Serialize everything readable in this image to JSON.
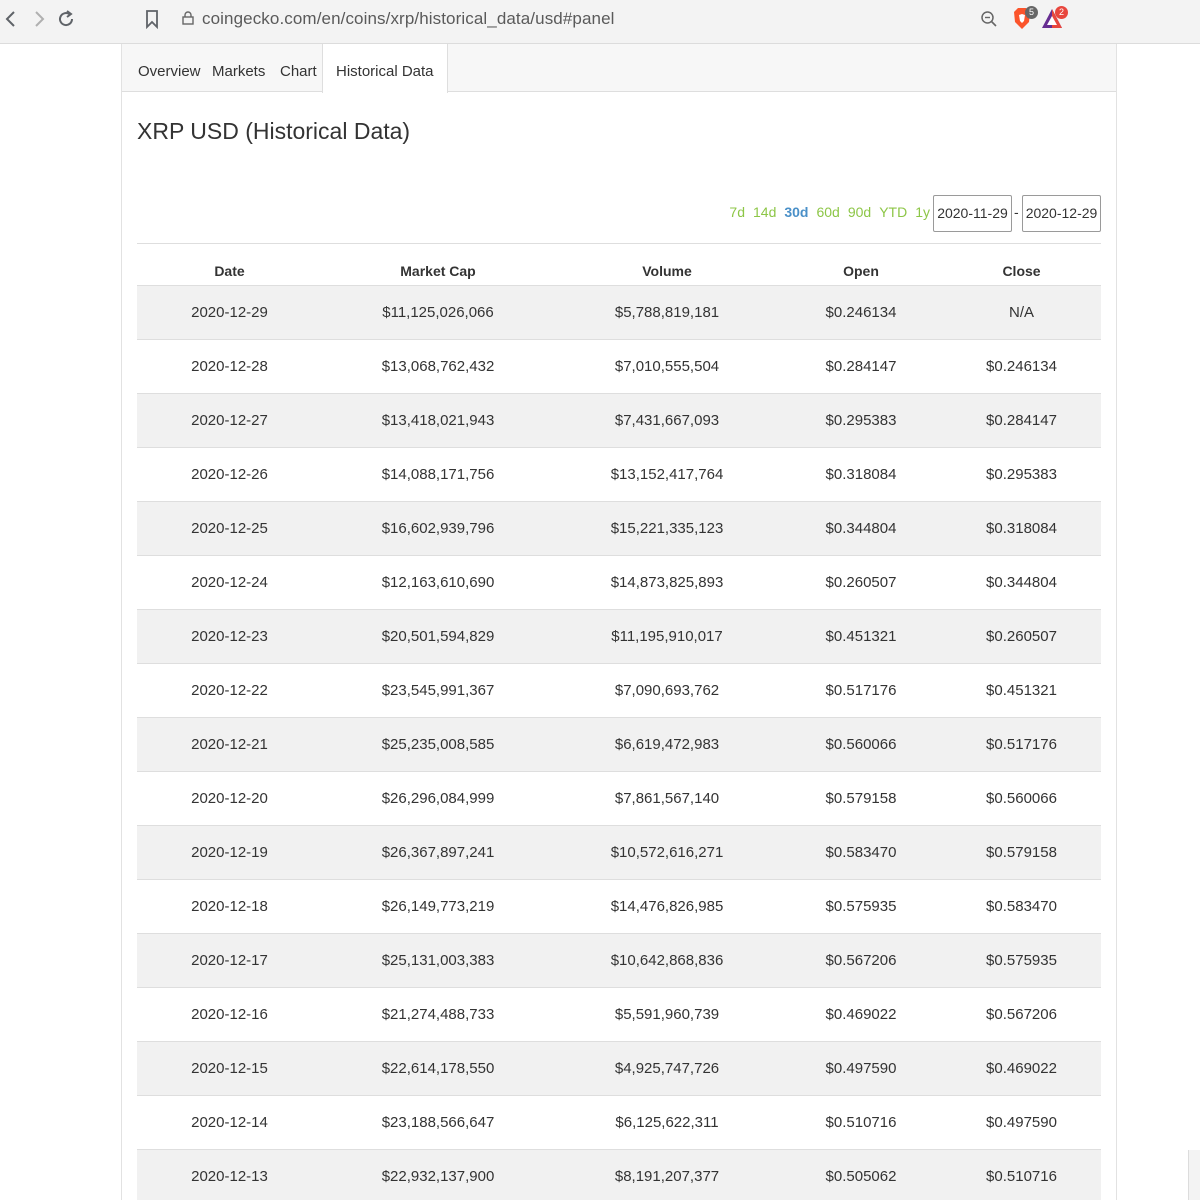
{
  "browser": {
    "url": "coingecko.com/en/coins/xrp/historical_data/usd#panel",
    "brave_shields_count": "5",
    "rewards_count": "2"
  },
  "tabs": [
    {
      "label": "Overview"
    },
    {
      "label": "Markets"
    },
    {
      "label": "Chart"
    },
    {
      "label": "Historical Data"
    }
  ],
  "page_title": "XRP USD (Historical Data)",
  "range_links": [
    "7d",
    "14d",
    "30d",
    "60d",
    "90d",
    "YTD",
    "1y"
  ],
  "active_range": "30d",
  "date_from": "2020-11-29",
  "date_to": "2020-12-29",
  "date_separator": "-",
  "table": {
    "headers": [
      "Date",
      "Market Cap",
      "Volume",
      "Open",
      "Close"
    ],
    "rows": [
      [
        "2020-12-29",
        "$11,125,026,066",
        "$5,788,819,181",
        "$0.246134",
        "N/A"
      ],
      [
        "2020-12-28",
        "$13,068,762,432",
        "$7,010,555,504",
        "$0.284147",
        "$0.246134"
      ],
      [
        "2020-12-27",
        "$13,418,021,943",
        "$7,431,667,093",
        "$0.295383",
        "$0.284147"
      ],
      [
        "2020-12-26",
        "$14,088,171,756",
        "$13,152,417,764",
        "$0.318084",
        "$0.295383"
      ],
      [
        "2020-12-25",
        "$16,602,939,796",
        "$15,221,335,123",
        "$0.344804",
        "$0.318084"
      ],
      [
        "2020-12-24",
        "$12,163,610,690",
        "$14,873,825,893",
        "$0.260507",
        "$0.344804"
      ],
      [
        "2020-12-23",
        "$20,501,594,829",
        "$11,195,910,017",
        "$0.451321",
        "$0.260507"
      ],
      [
        "2020-12-22",
        "$23,545,991,367",
        "$7,090,693,762",
        "$0.517176",
        "$0.451321"
      ],
      [
        "2020-12-21",
        "$25,235,008,585",
        "$6,619,472,983",
        "$0.560066",
        "$0.517176"
      ],
      [
        "2020-12-20",
        "$26,296,084,999",
        "$7,861,567,140",
        "$0.579158",
        "$0.560066"
      ],
      [
        "2020-12-19",
        "$26,367,897,241",
        "$10,572,616,271",
        "$0.583470",
        "$0.579158"
      ],
      [
        "2020-12-18",
        "$26,149,773,219",
        "$14,476,826,985",
        "$0.575935",
        "$0.583470"
      ],
      [
        "2020-12-17",
        "$25,131,003,383",
        "$10,642,868,836",
        "$0.567206",
        "$0.575935"
      ],
      [
        "2020-12-16",
        "$21,274,488,733",
        "$5,591,960,739",
        "$0.469022",
        "$0.567206"
      ],
      [
        "2020-12-15",
        "$22,614,178,550",
        "$4,925,747,726",
        "$0.497590",
        "$0.469022"
      ],
      [
        "2020-12-14",
        "$23,188,566,647",
        "$6,125,622,311",
        "$0.510716",
        "$0.497590"
      ],
      [
        "2020-12-13",
        "$22,932,137,900",
        "$8,191,207,377",
        "$0.505062",
        "$0.510716"
      ]
    ]
  },
  "colors": {
    "range_link": "#8dc647",
    "range_link_active": "#4a90c8",
    "row_stripe": "#f1f1f1"
  }
}
